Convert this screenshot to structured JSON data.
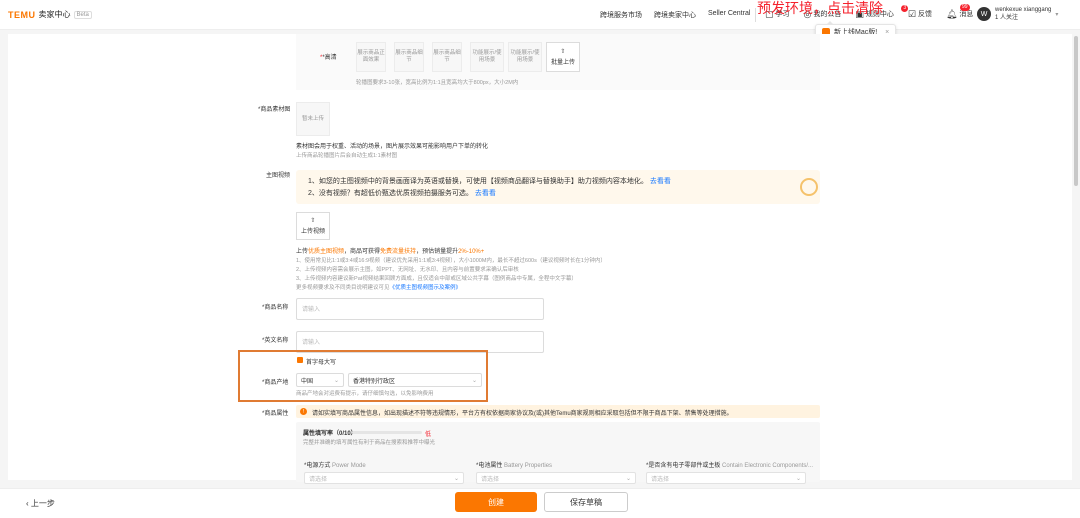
{
  "header": {
    "brand": "TEMU",
    "center": "卖家中心",
    "beta": "Beta",
    "nav": [
      "跨境服务市场",
      "跨境卖家中心",
      "Seller Central"
    ],
    "tools": {
      "learn": "学习",
      "notice": "我的公告",
      "rules": "规则中心",
      "rules_badge": "3",
      "feedback": "反馈",
      "messages": "消息",
      "messages_badge": "99"
    },
    "user": {
      "name": "wenkexue xianggang",
      "sub": "1 人关注",
      "avatar_letter": "W"
    },
    "dev_warning": "预发环境，点击清除",
    "tooltip": "新上线Mac版!"
  },
  "form": {
    "image_section": {
      "label": "*高清",
      "slots": [
        "展示商品正面效果",
        "展示商品细节",
        "展示商品细节",
        "功能展示/使用场景",
        "功能展示/使用场景"
      ],
      "batch_upload": "批量上传",
      "hint": "轮播图要求3-10张，宽高比例为1:1且宽高均大于800px，大小2M内"
    },
    "material": {
      "label": "*商品素材图",
      "upload": "暂未上传",
      "desc": "素材图会用于权重、活动的场景，图片展示效果可能影响用户下单的转化",
      "hint": "上传商品轮播图片后会自动生成1:1素材图"
    },
    "video": {
      "label": "主图视频",
      "notice1_text": "1、如您的主图视频中的背景画面译为英语或替换，可使用【视频商品翻译与替换助手】助力视频内容本地化。",
      "notice1_link": "去看看",
      "notice2_text": "2、没有视频？有超低价甄选优质视频拍摄服务可选。",
      "notice2_link": "去看看",
      "upload": "上传视频",
      "tip_prefix": "上传",
      "tip_highlight1": "优质主图视频",
      "tip_mid": "，商品可获得",
      "tip_highlight2": "免费流量扶持",
      "tip_mid2": "，预估销量提升",
      "tip_highlight3": "2%-10%+",
      "rules": [
        "1、使用常见比1:1或3:4或16:9视频（建议优先采用1:1或3:4视频），大小1000M内，最长不超过600s（建议视频时长在1分钟内）",
        "2、上传视频内容需会展示主图，如PPT、无网址、无水印、且内容与前置要求采确认后审核",
        "3、上传视频内容建议新Pat视频结果回顾方面成，且仅适合中部或区域公共字幕（图例商品中专属，全程中文字幕）"
      ],
      "more_text": "更多视频要求及不同类目说明建议可见",
      "more_link": "《优质主图视频图示及案例》"
    },
    "product_name": {
      "label": "*商品名称",
      "placeholder": "请输入"
    },
    "english_name": {
      "label": "*英文名称",
      "placeholder": "请输入"
    },
    "capitalize": "首字母大写",
    "origin": {
      "label": "*商品产地",
      "country": "中国",
      "region": "香港特别行政区",
      "hint": "商品产地会对运费有提示，请仔细慎勾选，以免影响费用"
    },
    "attributes": {
      "label": "*商品属性",
      "warning": "请如实填写商品属性信息，如出现描述不符等违规情形，平台方有权依据商家协议及(或)其他Temu商家规则相应采取包括但不限于商品下架、禁售等处理措施。",
      "fill_rate_label": "属性填写率（0/10）",
      "fill_rate_value": 0,
      "fill_level": "低",
      "fill_hint": "完整并准确的填写属性有利于商品在搜索和推荐中曝光",
      "fields": [
        {
          "label": "*电源方式",
          "label_en": "Power Mode",
          "placeholder": "请选择"
        },
        {
          "label": "*电池属性",
          "label_en": "Battery Properties",
          "placeholder": "请选择"
        },
        {
          "label": "*是否含有电子零部件或主板",
          "label_en": "Contain Electronic Components/...",
          "placeholder": "请选择"
        }
      ]
    }
  },
  "footer": {
    "back": "上一步",
    "create": "创建",
    "save_draft": "保存草稿"
  },
  "colors": {
    "accent": "#fb7701",
    "link": "#1677ff",
    "danger": "#f5222d",
    "frame": "#e07b33"
  }
}
